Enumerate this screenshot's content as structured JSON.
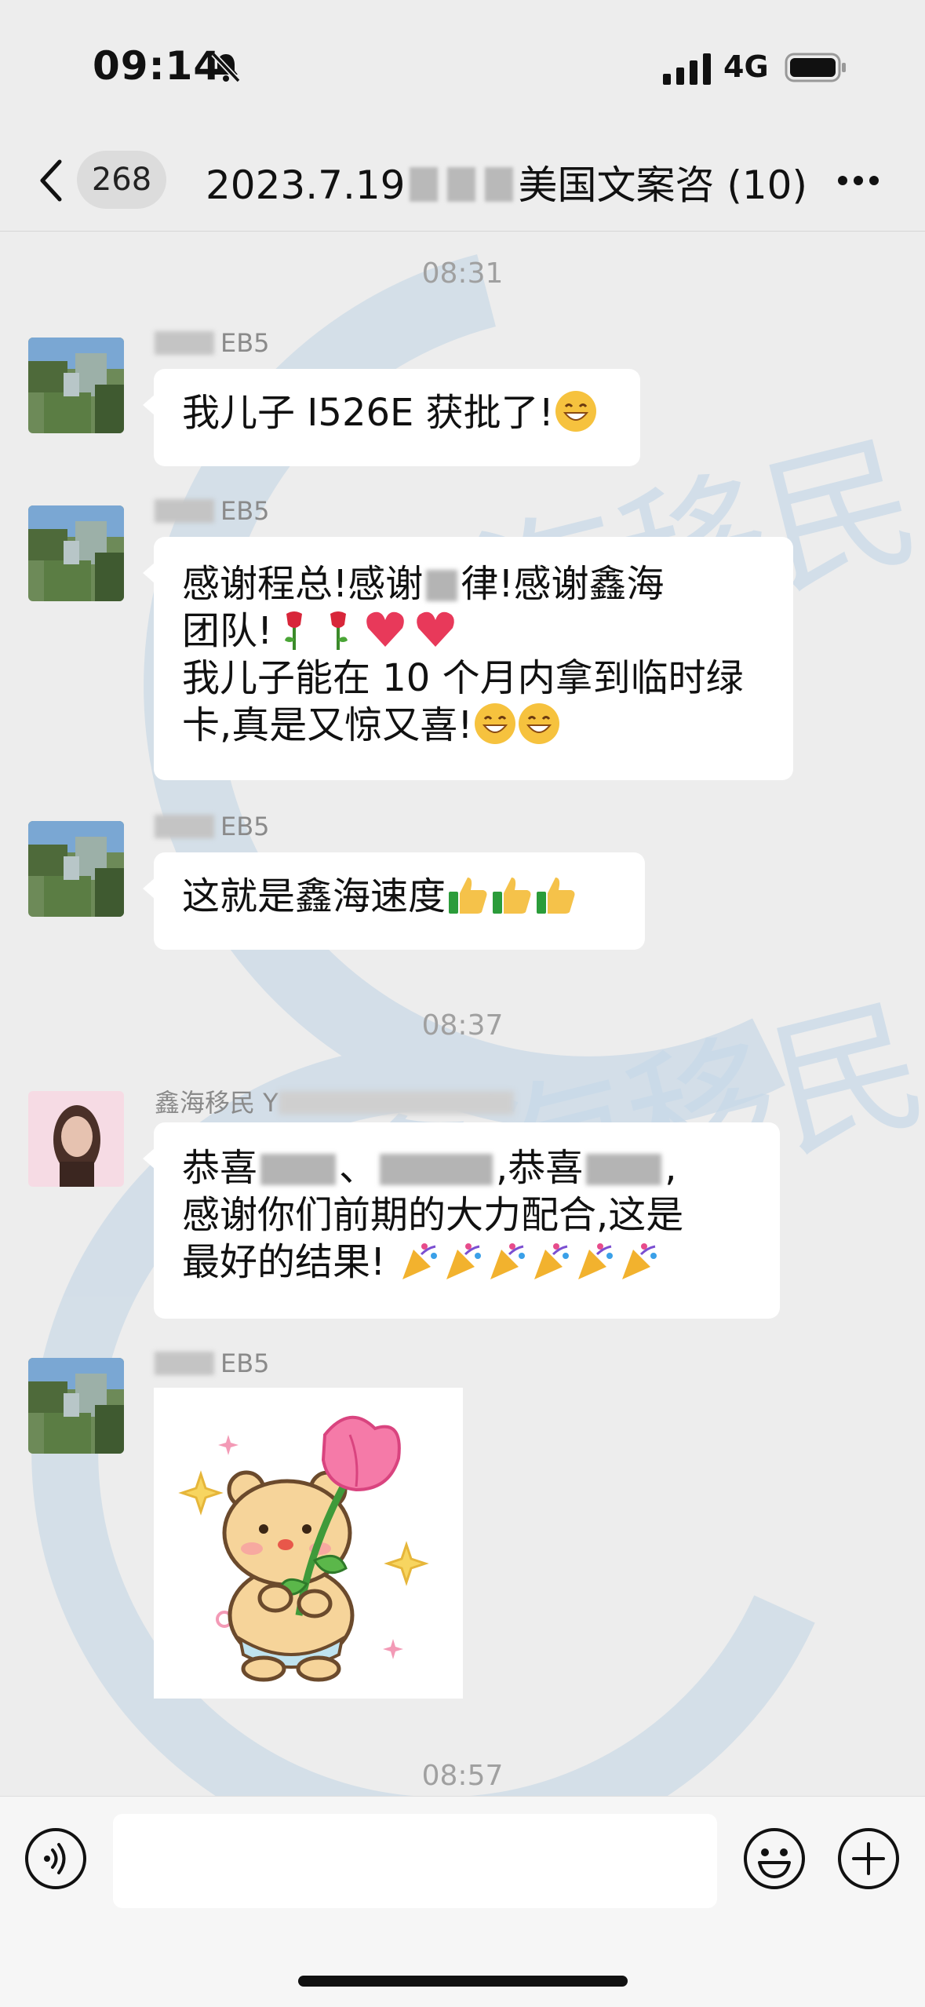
{
  "status": {
    "time": "09:14",
    "network": "4G"
  },
  "nav": {
    "badge": "268",
    "title_prefix": "2023.7.19",
    "title_suffix": "美国文案咨 (10)"
  },
  "watermark_text": "鑫海移民",
  "timestamps": [
    "08:31",
    "08:37",
    "08:57"
  ],
  "messages": [
    {
      "sender": "EB5",
      "text": "我儿子 I526E 获批了!"
    },
    {
      "sender": "EB5",
      "line1a": "感谢程总!感谢",
      "line1b": "律!感谢鑫海",
      "line2": "团队!",
      "line3": "我儿子能在 10 个月内拿到临时绿",
      "line4": "卡,真是又惊又喜!"
    },
    {
      "sender": "EB5",
      "text": "这就是鑫海速度"
    },
    {
      "sender": "鑫海移民 Y",
      "line1a": "恭喜",
      "line1b": "、",
      "line1c": ",恭喜",
      "line1d": ",",
      "line2": "感谢你们前期的大力配合,这是",
      "line3": "最好的结果!"
    },
    {
      "sender": "EB5"
    }
  ]
}
